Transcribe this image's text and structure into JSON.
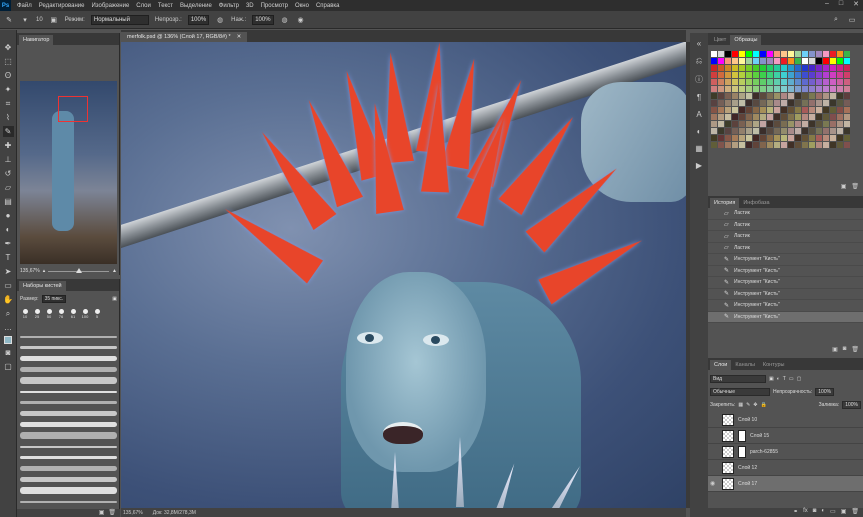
{
  "app": {
    "logo": "Ps"
  },
  "menu": [
    "Файл",
    "Редактирование",
    "Изображение",
    "Слои",
    "Текст",
    "Выделение",
    "Фильтр",
    "3D",
    "Просмотр",
    "Окно",
    "Справка"
  ],
  "options": {
    "brush_size": "10",
    "mode_label": "Режим:",
    "mode_value": "Нормальный",
    "opacity_label": "Непрозр.:",
    "opacity_value": "100%",
    "flow_label": "Наж.:",
    "flow_value": "100%"
  },
  "navigator": {
    "tab": "Навигатор",
    "zoom": "135,67%"
  },
  "brushes": {
    "tab": "Наборы кистей",
    "size_label": "Размер:",
    "size_value": "35 пикс.",
    "presets": [
      "10",
      "25",
      "50",
      "76",
      "61",
      "100",
      "5"
    ],
    "rows": [
      "",
      "",
      "",
      "",
      "",
      "",
      "",
      "",
      "",
      "",
      "",
      "",
      "",
      "",
      "",
      ""
    ]
  },
  "document": {
    "tab": "merfolk.psd @ 136% (Слой 17, RGB/8#) *",
    "status_zoom": "135,67%",
    "status_doc": "Док: 32,8M/278,3M"
  },
  "swatches": {
    "tabs": [
      "Цвет",
      "Образцы"
    ]
  },
  "history": {
    "tabs": [
      "История",
      "Инфобаза"
    ],
    "items": [
      {
        "label": "Ластик",
        "icon": "eraser-icon",
        "selected": false
      },
      {
        "label": "Ластик",
        "icon": "eraser-icon",
        "selected": false
      },
      {
        "label": "Ластик",
        "icon": "eraser-icon",
        "selected": false
      },
      {
        "label": "Ластик",
        "icon": "eraser-icon",
        "selected": false
      },
      {
        "label": "Инструмент \"Кисть\"",
        "icon": "brush-icon",
        "selected": false
      },
      {
        "label": "Инструмент \"Кисть\"",
        "icon": "brush-icon",
        "selected": false
      },
      {
        "label": "Инструмент \"Кисть\"",
        "icon": "brush-icon",
        "selected": false
      },
      {
        "label": "Инструмент \"Кисть\"",
        "icon": "brush-icon",
        "selected": false
      },
      {
        "label": "Инструмент \"Кисть\"",
        "icon": "brush-icon",
        "selected": false
      },
      {
        "label": "Инструмент \"Кисть\"",
        "icon": "brush-icon",
        "selected": true
      }
    ]
  },
  "layers": {
    "tabs": [
      "Слои",
      "Каналы",
      "Контуры"
    ],
    "filter": "Вид",
    "blend": "Обычные",
    "opacity_label": "Непрозрачность:",
    "opacity_value": "100%",
    "lock_label": "Закрепить:",
    "fill_label": "Заливка:",
    "fill_value": "100%",
    "items": [
      {
        "name": "Слой 10",
        "selected": false,
        "visible": false
      },
      {
        "name": "Слой 15",
        "selected": false,
        "visible": false
      },
      {
        "name": "parch-62855",
        "selected": false,
        "visible": false
      },
      {
        "name": "Слой 12",
        "selected": false,
        "visible": false
      },
      {
        "name": "Слой 17",
        "selected": true,
        "visible": true
      }
    ]
  },
  "colors": {
    "accent_red": "#e8452a",
    "selection": "#6e6e6e",
    "bg": "#535353"
  }
}
